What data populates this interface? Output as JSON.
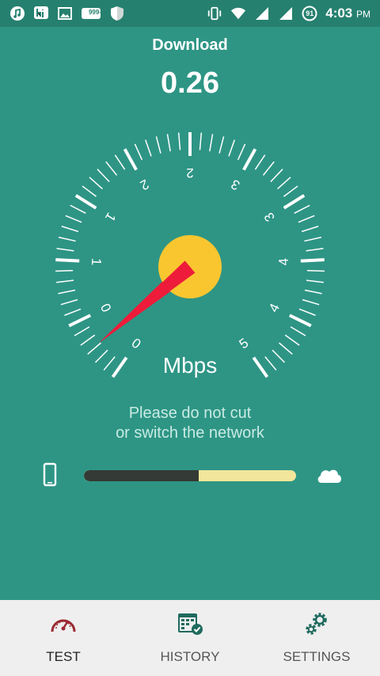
{
  "status_bar": {
    "time": "4:03",
    "ampm": "PM",
    "notification_badge": "999+",
    "battery_level": "91",
    "icons_left": [
      "music-note-icon",
      "hi-app-icon",
      "image-icon",
      "badge-icon",
      "shield-icon"
    ],
    "icons_right": [
      "vibrate-icon",
      "wifi-icon",
      "signal-icon",
      "signal-icon",
      "battery-icon"
    ]
  },
  "test": {
    "title": "Download",
    "value": "0.26",
    "unit": "Mbps",
    "notice_line1": "Please do not cut",
    "notice_line2": "or switch the network",
    "progress_fraction": 0.54
  },
  "gauge": {
    "scale_labels": [
      "0",
      "0",
      "1",
      "1",
      "2",
      "2",
      "3",
      "3",
      "4",
      "4",
      "5"
    ],
    "needle_value": 0.26,
    "needle_color": "#ee1c3a",
    "hub_color": "#f9c630"
  },
  "bottom_nav": {
    "items": [
      {
        "label": "TEST",
        "icon": "speedometer-icon",
        "active": true
      },
      {
        "label": "HISTORY",
        "icon": "calendar-check-icon",
        "active": false
      },
      {
        "label": "SETTINGS",
        "icon": "gears-icon",
        "active": false
      }
    ]
  }
}
